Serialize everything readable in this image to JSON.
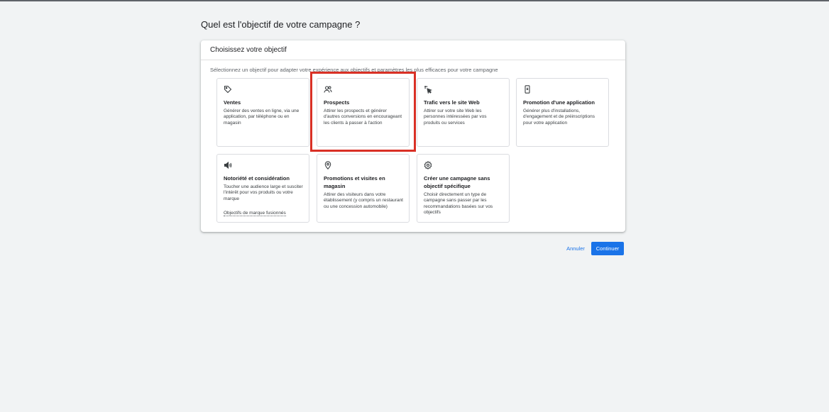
{
  "page": {
    "title": "Quel est l'objectif de votre campagne ?"
  },
  "panel": {
    "title": "Choisissez votre objectif",
    "subtitle": "Sélectionnez un objectif pour adapter votre expérience aux objectifs et paramètres les plus efficaces pour votre campagne"
  },
  "objectives": [
    {
      "icon": "tag-icon",
      "title": "Ventes",
      "description": "Générer des ventes en ligne, via une application, par téléphone ou en magasin"
    },
    {
      "icon": "people-icon",
      "title": "Prospects",
      "description": "Attirer les prospects et générer d'autres conversions en encourageant les clients à passer à l'action"
    },
    {
      "icon": "cursor-click-icon",
      "title": "Trafic vers le site Web",
      "description": "Attirer sur votre site Web les personnes intéressées par vos produits ou services"
    },
    {
      "icon": "phone-icon",
      "title": "Promotion d'une application",
      "description": "Générer plus d'installations, d'engagement et de préinscriptions pour votre application"
    },
    {
      "icon": "megaphone-icon",
      "title": "Notoriété et considération",
      "description": "Toucher une audience large et susciter l'intérêt pour vos produits ou votre marque",
      "link": "Objectifs de marque fusionnés"
    },
    {
      "icon": "location-pin-icon",
      "title": "Promotions et visites en magasin",
      "description": "Attirer des visiteurs dans votre établissement (y compris un restaurant ou une concession automobile)"
    },
    {
      "icon": "settings-gear-icon",
      "title": "Créer une campagne sans objectif spécifique",
      "description": "Choisir directement un type de campagne sans passer par les recommandations basées sur vos objectifs"
    }
  ],
  "actions": {
    "cancel": "Annuler",
    "continue": "Continuer"
  },
  "colors": {
    "accent": "#1a73e8",
    "highlight": "#d93025",
    "background": "#f1f3f4"
  }
}
